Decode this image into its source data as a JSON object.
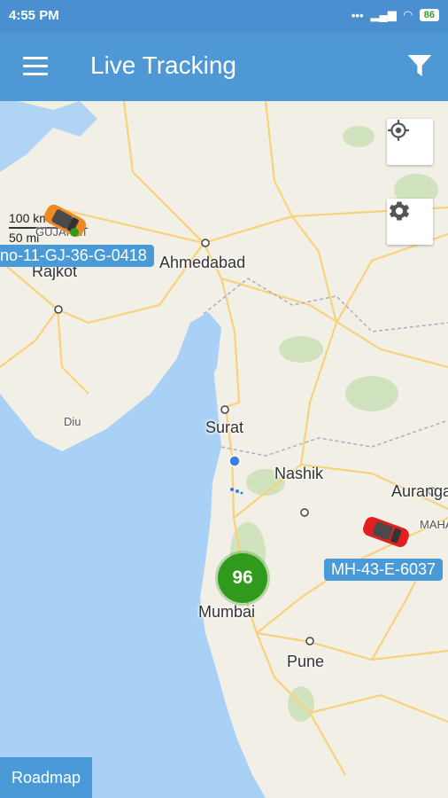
{
  "status": {
    "time": "4:55 PM",
    "battery": "86",
    "icons": [
      "dots-icon",
      "signal-icon",
      "wifi-icon"
    ]
  },
  "appbar": {
    "title": "Live Tracking",
    "menu_icon": "menu-icon",
    "filter_icon": "filter-icon"
  },
  "map": {
    "scale_km": "100 km",
    "scale_mi": "50 mi",
    "cities": {
      "ahmedabad": "Ahmedabad",
      "rajkot": "Rajkot",
      "gujarat": "GUJARAT",
      "diu": "Diu",
      "surat": "Surat",
      "nashik": "Nashik",
      "aurangabad": "Aurangab",
      "maha": "MAHA",
      "mumbai": "Mumbai",
      "pune": "Pune"
    },
    "cluster_count": "96",
    "vehicles": [
      {
        "plate": "no-11-GJ-36-G-0418",
        "color": "#f08a24"
      },
      {
        "plate": "MH-43-E-6037",
        "color": "#e02020"
      }
    ],
    "map_type_button": "Roadmap",
    "colors": {
      "sea": "#a9d0f5",
      "land": "#f2efe7",
      "road": "#f8d27a",
      "accent": "#4a9ad8",
      "cluster": "#2f9a1b"
    }
  }
}
